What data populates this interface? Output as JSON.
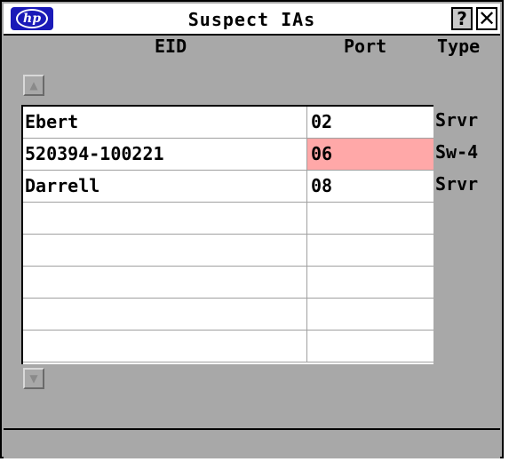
{
  "window": {
    "title": "Suspect IAs",
    "logo_text": "hp"
  },
  "titlebar": {
    "help_label": "?",
    "close_label": "✕"
  },
  "columns": {
    "eid": "EID",
    "port": "Port",
    "type": "Type"
  },
  "rows": [
    {
      "eid": "Ebert",
      "port": "02",
      "type": "Srvr",
      "port_alert": false
    },
    {
      "eid": "520394-100221",
      "port": "06",
      "type": "Sw-4",
      "port_alert": true
    },
    {
      "eid": "Darrell",
      "port": "08",
      "type": "Srvr",
      "port_alert": false
    },
    {
      "eid": "",
      "port": "",
      "type": "",
      "port_alert": false
    },
    {
      "eid": "",
      "port": "",
      "type": "",
      "port_alert": false
    },
    {
      "eid": "",
      "port": "",
      "type": "",
      "port_alert": false
    },
    {
      "eid": "",
      "port": "",
      "type": "",
      "port_alert": false
    },
    {
      "eid": "",
      "port": "",
      "type": "",
      "port_alert": false
    }
  ],
  "colors": {
    "alert": "#ffa8a8",
    "background": "#a8a8a8",
    "logo": "#1a1ab8"
  },
  "icons": {
    "scroll_up": "chevron-up-icon",
    "scroll_down": "chevron-down-icon"
  }
}
